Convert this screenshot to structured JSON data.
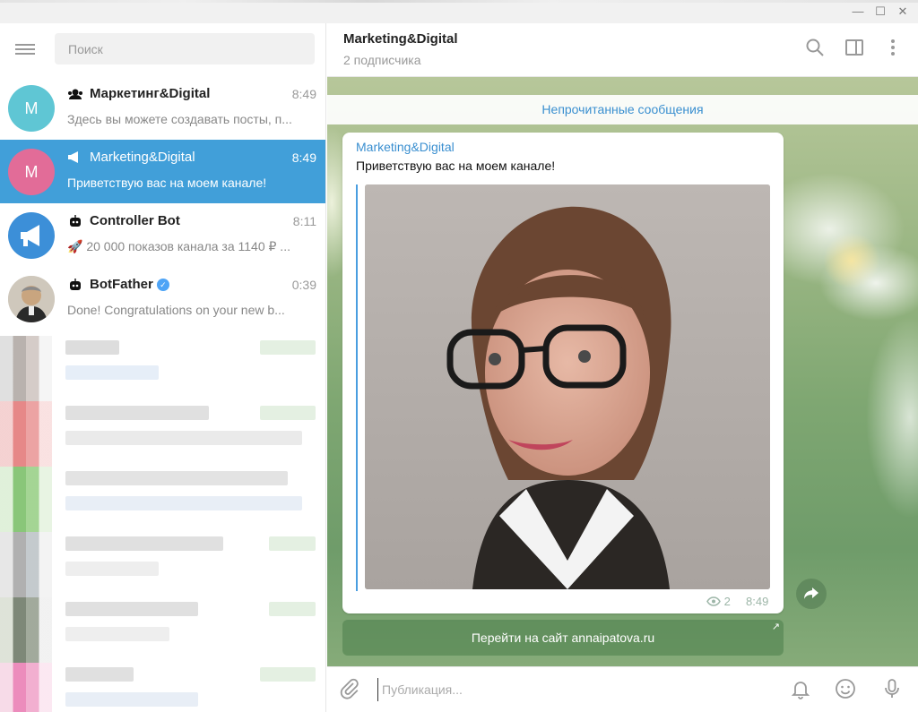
{
  "window": {
    "controls": [
      "—",
      "☐",
      "✕"
    ]
  },
  "sidebar": {
    "search_placeholder": "Поиск",
    "chats": [
      {
        "name": "Маркетинг&Digital",
        "time": "8:49",
        "preview": "Здесь вы можете создавать посты, п...",
        "avatar_letter": "M",
        "avatar_color": "#5fc6d4",
        "icon": "group-icon",
        "active": false
      },
      {
        "name": "Marketing&Digital",
        "time": "8:49",
        "preview": "Приветствую вас на моем канале!",
        "avatar_letter": "M",
        "avatar_color": "#e26c98",
        "icon": "megaphone-icon",
        "active": true
      },
      {
        "name": "Controller Bot",
        "time": "8:11",
        "preview": "🚀 20 000 показов канала за 1140 ₽ ...",
        "avatar_letter": "",
        "avatar_color": "#3c8fd8",
        "icon": "bot-icon",
        "active": false
      },
      {
        "name": "BotFather",
        "time": "0:39",
        "preview": "Done! Congratulations on your new b...",
        "avatar_letter": "",
        "avatar_color": "#7a6e62",
        "icon": "bot-icon",
        "active": false
      }
    ]
  },
  "channel": {
    "title": "Marketing&Digital",
    "subtitle": "2 подписчика"
  },
  "messages": {
    "unread_banner": "Непрочитанные сообщения",
    "post": {
      "author": "Marketing&Digital",
      "text": "Приветствую вас на моем канале!",
      "views": "2",
      "time": "8:49"
    },
    "link_button": "Перейти на сайт annaipatova.ru"
  },
  "composer": {
    "placeholder": "Публикация..."
  },
  "colors": {
    "accent": "#419fd9",
    "link": "#3a8fd0"
  }
}
